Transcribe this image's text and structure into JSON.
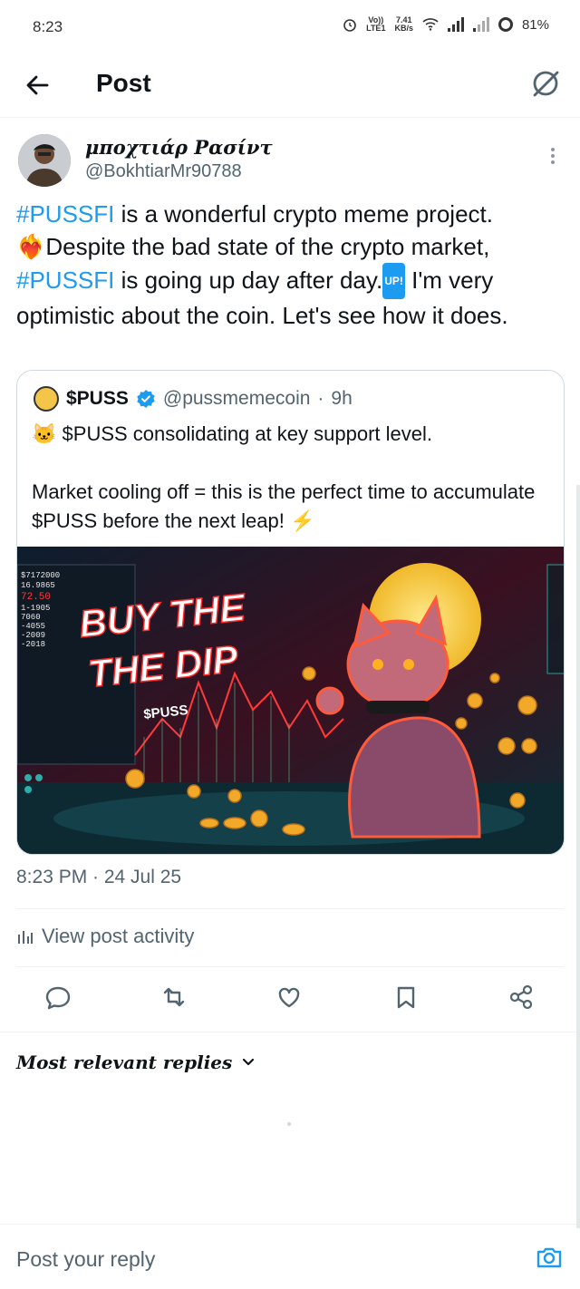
{
  "status_bar": {
    "time": "8:23",
    "volte_top": "Vo))",
    "volte_bottom": "LTE1",
    "speed_top": "7.41",
    "speed_bottom": "KB/s",
    "battery": "81%"
  },
  "header": {
    "title": "Post",
    "back_icon": "arrow-left-icon",
    "grok_icon": "grok-icon"
  },
  "post": {
    "author_name": "μποχτιάρ Ρασίντ",
    "author_handle": "@BokhtiarMr90788",
    "text": {
      "hashtag1": "#PUSSFI",
      "part1": " is a wonderful crypto meme project.",
      "emoji_heart": "❤️‍🔥",
      "part2": "Despite the bad state of the crypto market,",
      "hashtag2": "#PUSSFI",
      "part3": " is going up day after day.",
      "up_badge": "UP!",
      "part4": " I'm very optimistic about the coin. Let's see how it does."
    },
    "timestamp": "8:23 PM · 24 Jul 25",
    "activity_label": "View post activity"
  },
  "quote": {
    "name": "$PUSS",
    "handle": "@pussmemecoin",
    "separator": "·",
    "time": "9h",
    "line1_emoji": "🐱",
    "line1": "$PUSS consolidating at key support level.",
    "line2": "Market cooling off = this is the perfect time to accumulate $PUSS before the next leap!",
    "line2_emoji": "⚡",
    "image": {
      "headline_line1": "BUY THE",
      "headline_line2": "THE DIP",
      "ticker": "$PUSS",
      "chart_labels": [
        "$7172000",
        "16.9865",
        "72.50",
        "1-1905",
        "7060",
        "-4055",
        "-2009",
        "-2018"
      ]
    }
  },
  "actions": {
    "reply_icon": "reply-icon",
    "repost_icon": "repost-icon",
    "like_icon": "heart-icon",
    "bookmark_icon": "bookmark-icon",
    "share_icon": "share-icon"
  },
  "replies": {
    "sort_label": "Most relevant replies"
  },
  "reply_bar": {
    "placeholder": "Post your reply"
  },
  "colors": {
    "accent": "#1d9bf0",
    "text": "#0f1419",
    "secondary": "#536471",
    "border": "#cfd9de"
  }
}
